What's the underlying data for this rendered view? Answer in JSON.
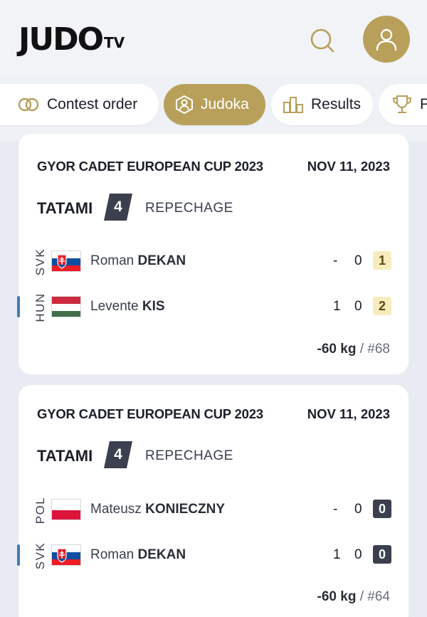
{
  "header": {
    "logo_main": "JUDO",
    "logo_sub": "TV"
  },
  "tabs": [
    {
      "label": "Contest order",
      "active": false
    },
    {
      "label": "Judoka",
      "active": true
    },
    {
      "label": "Results",
      "active": false
    },
    {
      "label": "P",
      "active": false
    }
  ],
  "colors": {
    "accent_gold": "#b8a05a",
    "dark": "#3b3f4e",
    "winner_bar": "#3f7db3",
    "shido_gold_bg": "#f8ebbd"
  },
  "contests": [
    {
      "event": "GYOR CADET EUROPEAN CUP 2023",
      "date": "NOV 11, 2023",
      "tatami_label": "TATAMI",
      "tatami": "4",
      "round": "REPECHAGE",
      "athletes": [
        {
          "country": "SVK",
          "first": "Roman",
          "last": "DEKAN",
          "score1": "-",
          "score2": "0",
          "shido": "1",
          "shido_style": "gold",
          "winner": false
        },
        {
          "country": "HUN",
          "first": "Levente",
          "last": "KIS",
          "score1": "1",
          "score2": "0",
          "shido": "2",
          "shido_style": "gold",
          "winner": true
        }
      ],
      "weight": "-60 kg",
      "contest_no": " / #68"
    },
    {
      "event": "GYOR CADET EUROPEAN CUP 2023",
      "date": "NOV 11, 2023",
      "tatami_label": "TATAMI",
      "tatami": "4",
      "round": "REPECHAGE",
      "athletes": [
        {
          "country": "POL",
          "first": "Mateusz",
          "last": "KONIECZNY",
          "score1": "-",
          "score2": "0",
          "shido": "0",
          "shido_style": "dark",
          "winner": false
        },
        {
          "country": "SVK",
          "first": "Roman",
          "last": "DEKAN",
          "score1": "1",
          "score2": "0",
          "shido": "0",
          "shido_style": "dark",
          "winner": true
        }
      ],
      "weight": "-60 kg",
      "contest_no": " / #64"
    }
  ]
}
